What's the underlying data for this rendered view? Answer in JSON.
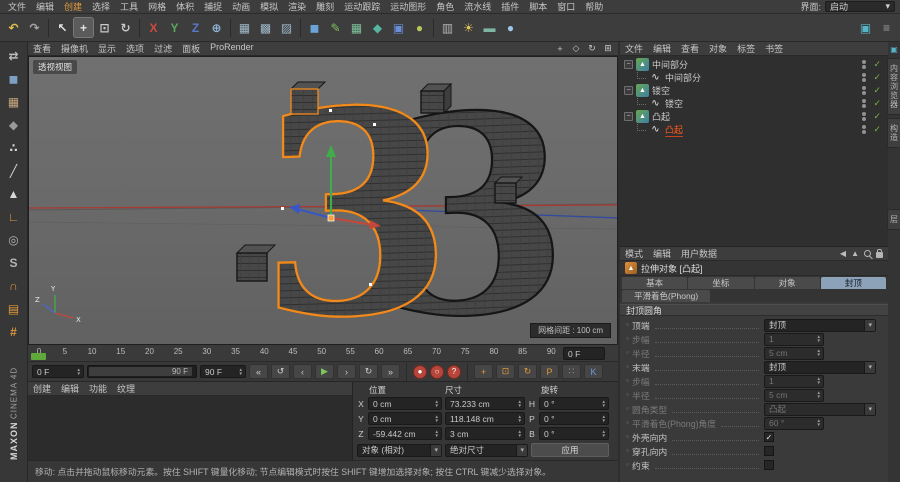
{
  "menubar": {
    "items": [
      "文件",
      "编辑",
      "创建",
      "选择",
      "工具",
      "网格",
      "体积",
      "捕捉",
      "动画",
      "模拟",
      "渲染",
      "雕刻",
      "运动跟踪",
      "运动图形",
      "角色",
      "流水线",
      "插件",
      "脚本",
      "窗口",
      "帮助"
    ],
    "accent_item": "创建",
    "interface_label": "界面:",
    "interface_value": "启动"
  },
  "icons": {
    "chevron_down": "▾",
    "minus": "−",
    "check": "✓",
    "stepper_up": "▲",
    "stepper_down": "▼",
    "anim_dot": "○",
    "back_arrow": "◀",
    "up_arrow": "▲",
    "panel_box": "▣"
  },
  "toolbar": {
    "icons": [
      {
        "name": "undo-icon",
        "glyph": "↶",
        "color": "#e4c14b"
      },
      {
        "name": "redo-icon",
        "glyph": "↷",
        "color": "#a6a6a6"
      },
      {
        "sep": true
      },
      {
        "name": "live-selection-icon",
        "glyph": "↖",
        "color": "#e6e6e6"
      },
      {
        "name": "move-tool-icon",
        "glyph": "+",
        "color": "#e2e2e2",
        "active": true
      },
      {
        "name": "scale-tool-icon",
        "glyph": "⊡",
        "color": "#c9c9c9"
      },
      {
        "name": "rotate-tool-icon",
        "glyph": "↻",
        "color": "#c9c9c9"
      },
      {
        "sep": true
      },
      {
        "name": "lock-x-axis-icon",
        "glyph": "X",
        "color": "#cf4a3e"
      },
      {
        "name": "lock-y-axis-icon",
        "glyph": "Y",
        "color": "#58a65c"
      },
      {
        "name": "lock-z-axis-icon",
        "glyph": "Z",
        "color": "#5a77c9"
      },
      {
        "name": "coordinate-system-icon",
        "glyph": "⊕",
        "color": "#8fb5d8"
      },
      {
        "sep": true
      },
      {
        "name": "render-view-icon",
        "glyph": "▦",
        "color": "#9fb8c8"
      },
      {
        "name": "render-picture-viewer-icon",
        "glyph": "▩",
        "color": "#9fb8c8"
      },
      {
        "name": "render-settings-icon",
        "glyph": "▨",
        "color": "#9fb8c8"
      },
      {
        "sep": true
      },
      {
        "name": "cube-primitive-icon",
        "glyph": "◼",
        "color": "#6aa3d8"
      },
      {
        "name": "spline-pen-icon",
        "glyph": "✎",
        "color": "#7fc25e"
      },
      {
        "name": "subdivision-surface-icon",
        "glyph": "▦",
        "color": "#7fc29b"
      },
      {
        "name": "extrude-generator-icon",
        "glyph": "◆",
        "color": "#55b5a0"
      },
      {
        "name": "volume-builder-icon",
        "glyph": "▣",
        "color": "#6a8fd8"
      },
      {
        "name": "field-object-icon",
        "glyph": "●",
        "color": "#b5c95a"
      },
      {
        "sep": true
      },
      {
        "name": "camera-icon",
        "glyph": "▥",
        "color": "#b5b5b5"
      },
      {
        "name": "light-icon",
        "glyph": "☀",
        "color": "#e0c75a"
      },
      {
        "name": "floor-icon",
        "glyph": "▬",
        "color": "#7fb5a5"
      },
      {
        "name": "sky-icon",
        "glyph": "●",
        "color": "#9fc5e8"
      }
    ],
    "right_icons": [
      {
        "name": "workspace-palette-icon",
        "glyph": "▣",
        "color": "#55b5c9"
      },
      {
        "name": "layout-options-icon",
        "glyph": "≡",
        "color": "#a0a0a0"
      }
    ]
  },
  "left_toolbar": {
    "icons": [
      {
        "name": "make-editable-icon",
        "glyph": "⇄",
        "color": "#bdbdbd"
      },
      {
        "name": "model-mode-icon",
        "glyph": "◼",
        "color": "#7d9fc4"
      },
      {
        "name": "texture-mode-icon",
        "glyph": "▦",
        "color": "#c4a57d"
      },
      {
        "name": "workplane-mode-icon",
        "glyph": "◆",
        "color": "#9a9a9a"
      },
      {
        "name": "points-mode-icon",
        "glyph": "∴",
        "color": "#d8d8d8"
      },
      {
        "name": "edges-mode-icon",
        "glyph": "╱",
        "color": "#d8d8d8"
      },
      {
        "name": "polygons-mode-icon",
        "glyph": "▲",
        "color": "#d8d8d8"
      },
      {
        "name": "enable-axis-icon",
        "glyph": "∟",
        "color": "#e0973a"
      },
      {
        "name": "viewport-solo-icon",
        "glyph": "◎",
        "color": "#b5b5b5"
      },
      {
        "name": "snap-mode-icon",
        "glyph": "S",
        "color": "#b5b5b5"
      },
      {
        "name": "enable-snap-icon",
        "glyph": "∩",
        "color": "#e0973a"
      },
      {
        "name": "workplane-lock-icon",
        "glyph": "▤",
        "color": "#e0973a"
      },
      {
        "name": "quantize-icon",
        "glyph": "#",
        "color": "#e0973a"
      }
    ]
  },
  "branding": {
    "line1": "MAXON",
    "line2": "CINEMA 4D"
  },
  "viewport": {
    "menu_items": [
      "查看",
      "摄像机",
      "显示",
      "选项",
      "过滤",
      "面板",
      "ProRender"
    ],
    "view_icons": [
      {
        "name": "pan-view-icon",
        "glyph": "+"
      },
      {
        "name": "dolly-view-icon",
        "glyph": "◇"
      },
      {
        "name": "orbit-view-icon",
        "glyph": "↻"
      },
      {
        "name": "toggle-views-icon",
        "glyph": "⊞"
      }
    ],
    "view_label": "透视视图",
    "grid_label": "网格间距 : 100 cm",
    "model_glyph": "3",
    "axis_labels": {
      "x": "X",
      "y": "Y",
      "z": "Z"
    }
  },
  "timeline": {
    "ticks": [
      "0",
      "5",
      "10",
      "15",
      "20",
      "25",
      "30",
      "35",
      "40",
      "45",
      "50",
      "55",
      "60",
      "65",
      "70",
      "75",
      "80",
      "85",
      "90"
    ],
    "ruler_field": "0 F"
  },
  "transport": {
    "current_frame": "0 F",
    "range_label": "90 F",
    "end_frame": "90 F",
    "buttons": [
      {
        "name": "goto-start-button",
        "glyph": "«"
      },
      {
        "name": "play-backwards-button",
        "glyph": "↺"
      },
      {
        "name": "previous-frame-button",
        "glyph": "‹"
      },
      {
        "name": "play-forwards-button",
        "glyph": "▶",
        "color": "#7ec75a"
      },
      {
        "name": "next-frame-button",
        "glyph": "›"
      },
      {
        "name": "play-loop-button",
        "glyph": "↻"
      },
      {
        "name": "goto-end-button",
        "glyph": "»"
      },
      {
        "sep": true
      },
      {
        "name": "record-keyframe-button",
        "glyph": "●",
        "circle": "#b8453a"
      },
      {
        "name": "autokeying-button",
        "glyph": "○",
        "circle": "#b8453a"
      },
      {
        "name": "record-settings-button",
        "glyph": "?",
        "circle": "#b8453a"
      },
      {
        "sep": true
      },
      {
        "name": "record-position-toggle",
        "glyph": "+",
        "color": "#e0973a"
      },
      {
        "name": "record-scale-toggle",
        "glyph": "⊡",
        "color": "#e0973a"
      },
      {
        "name": "record-rotation-toggle",
        "glyph": "↻",
        "color": "#e0973a"
      },
      {
        "name": "record-parameter-toggle",
        "glyph": "P",
        "color": "#e0973a"
      },
      {
        "name": "point-level-animation-toggle",
        "glyph": "∷",
        "color": "#9a9a9a"
      },
      {
        "name": "keyframe-selection-toggle",
        "glyph": "K",
        "color": "#6a9fd8"
      }
    ]
  },
  "material_manager": {
    "menu_items": [
      "创建",
      "编辑",
      "功能",
      "纹理"
    ]
  },
  "coordinates": {
    "headers": [
      "位置",
      "尺寸",
      "旋转"
    ],
    "rows": [
      {
        "axis": "X",
        "position": "0 cm",
        "size": "73.233 cm",
        "rot_axis": "H",
        "rotation": "0 °"
      },
      {
        "axis": "Y",
        "position": "0 cm",
        "size": "118.148 cm",
        "rot_axis": "P",
        "rotation": "0 °"
      },
      {
        "axis": "Z",
        "position": "-59.442 cm",
        "size": "3 cm",
        "rot_axis": "B",
        "rotation": "0 °"
      }
    ],
    "mode_dropdown": "对象 (相对)",
    "size_dropdown": "绝对尺寸",
    "apply_button": "应用"
  },
  "status_bar": {
    "text": "移动: 点击并拖动鼠标移动元素。按住 SHIFT 键量化移动; 节点编辑模式时按住 SHIFT 键增加选择对象; 按住 CTRL 键减少选择对象。"
  },
  "object_manager": {
    "menu_items": [
      "文件",
      "编辑",
      "查看",
      "对象",
      "标签",
      "书签"
    ],
    "tree": [
      {
        "label": "中间部分",
        "depth": 0,
        "type": "extrude",
        "selected": false
      },
      {
        "label": "中间部分",
        "depth": 1,
        "type": "spline",
        "selected": false
      },
      {
        "label": "镂空",
        "depth": 0,
        "type": "extrude",
        "selected": false
      },
      {
        "label": "镂空",
        "depth": 1,
        "type": "spline",
        "selected": false
      },
      {
        "label": "凸起",
        "depth": 0,
        "type": "extrude",
        "selected": false
      },
      {
        "label": "凸起",
        "depth": 1,
        "type": "spline",
        "selected": true
      }
    ]
  },
  "attribute_manager": {
    "menu_items": [
      "模式",
      "编辑",
      "用户数据"
    ],
    "title": "拉伸对象 [凸起]",
    "tabs": [
      "基本",
      "坐标",
      "对象",
      "封顶"
    ],
    "active_tab": "封顶",
    "tabs_row2": [
      "平滑着色(Phong)"
    ],
    "section": "封顶圆角",
    "rows": [
      {
        "label": "顶端",
        "control": "select",
        "value": "封顶",
        "enabled": true
      },
      {
        "label": "步幅",
        "control": "number",
        "value": "1",
        "enabled": false
      },
      {
        "label": "半径",
        "control": "number",
        "value": "5 cm",
        "enabled": false
      },
      {
        "label": "末端",
        "control": "select",
        "value": "封顶",
        "enabled": true
      },
      {
        "label": "步幅",
        "control": "number",
        "value": "1",
        "enabled": false
      },
      {
        "label": "半径",
        "control": "number",
        "value": "5 cm",
        "enabled": false
      },
      {
        "label": "圆角类型",
        "control": "select",
        "value": "凸起",
        "enabled": false
      },
      {
        "label": "平滑着色(Phong)角度",
        "control": "number",
        "value": "60 °",
        "enabled": false
      },
      {
        "label": "外壳向内",
        "control": "checkbox",
        "checked": true,
        "enabled": true
      },
      {
        "label": "穿孔向内",
        "control": "checkbox",
        "checked": false,
        "enabled": true
      },
      {
        "label": "约束",
        "control": "checkbox",
        "checked": false,
        "enabled": true
      }
    ]
  },
  "right_strip": {
    "tabs": [
      "内容浏览器",
      "构造",
      "层"
    ]
  },
  "colors": {
    "accent_orange": "#e0973a",
    "selected_text": "#ff5a1f",
    "check_green": "#7cb342",
    "axis_x": "#c4473a",
    "axis_y": "#3fae4a",
    "axis_z": "#3a56c4",
    "tab_active": "#8ba2b8"
  }
}
